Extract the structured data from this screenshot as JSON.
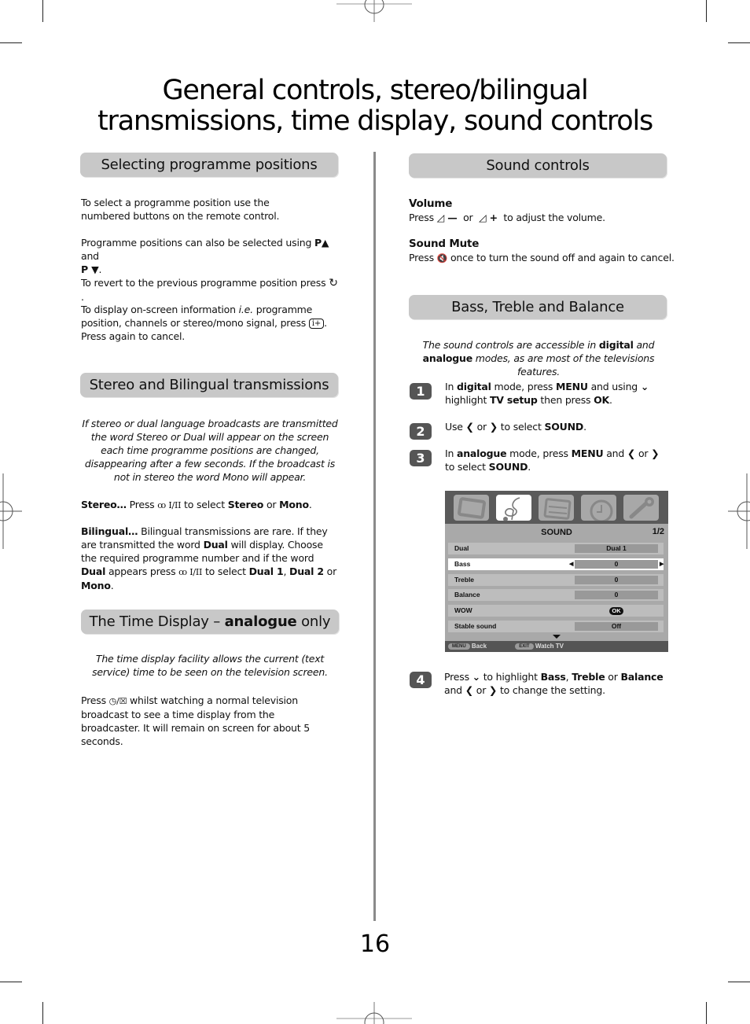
{
  "page": {
    "title_line1": "General controls, stereo/bilingual",
    "title_line2": "transmissions, time display, sound controls",
    "page_number": "16"
  },
  "left": {
    "selecting": {
      "heading": "Selecting programme positions",
      "p1": "To select a programme position use the numbered buttons on the remote control.",
      "p2_a": "Programme positions can also be selected using ",
      "p2_b": "P▲",
      "p2_c": " and ",
      "p2_d": "P ▼",
      "p2_e": ".",
      "p3_a": "To revert to the previous programme position press ",
      "p3_icon": "↻",
      "p3_b": ".",
      "p4_a": "To display on-screen information ",
      "p4_ie": "i.e.",
      "p4_b": " programme position, channels or stereo/mono signal, press ",
      "p4_icon": "i+",
      "p4_c": ". Press again to cancel."
    },
    "stereo": {
      "heading": "Stereo and Bilingual transmissions",
      "intro": "If stereo or dual language broadcasts are transmitted the word Stereo or Dual will appear on the screen each time programme positions are changed, disappearing after a few seconds. If the broadcast is not in stereo the word Mono will appear.",
      "stereo_lead": "Stereo…",
      "stereo_a": " Press ",
      "stereo_icon": "ꝏ I/II",
      "stereo_b": " to select ",
      "stereo_c": "Stereo",
      "stereo_d": " or ",
      "stereo_e": "Mono",
      "stereo_f": ".",
      "bi_lead": "Bilingual…",
      "bi_a": " Bilingual transmissions are rare. If they are transmitted the word ",
      "bi_b": "Dual",
      "bi_c": " will display. Choose the required programme number and if the word ",
      "bi_d": "Dual",
      "bi_e": " appears press ",
      "bi_icon": "ꝏ I/II",
      "bi_f": " to select ",
      "bi_g": "Dual 1",
      "bi_h": ", ",
      "bi_i": "Dual 2",
      "bi_j": " or ",
      "bi_k": "Mono",
      "bi_l": "."
    },
    "time": {
      "heading_a": "The Time Display – ",
      "heading_b": "analogue",
      "heading_c": " only",
      "intro": "The time display facility allows the current (text service) time to be seen on the television screen.",
      "p_a": "Press ",
      "p_icon": "◷/☒",
      "p_b": " whilst watching a normal television broadcast to see a time display from the broadcaster. It will remain on screen for about 5 seconds."
    }
  },
  "right": {
    "sound": {
      "heading": "Sound controls",
      "volume_title": "Volume",
      "volume_a": "Press ",
      "volume_minus": "◿ —",
      "volume_b": "  or  ",
      "volume_plus": "◿ +",
      "volume_c": "  to adjust the volume.",
      "mute_title": "Sound Mute",
      "mute_a": "Press ",
      "mute_icon": "🔇",
      "mute_b": " once to turn the sound off and again to cancel."
    },
    "btb": {
      "heading": "Bass, Treble and Balance",
      "intro_a": "The sound controls are accessible in ",
      "intro_b": "digital",
      "intro_c": " and ",
      "intro_d": "analogue",
      "intro_e": " modes, as are most of the televisions features.",
      "steps": [
        {
          "num": "1",
          "a": "In ",
          "b": "digital",
          "c": " mode, press ",
          "d": "MENU",
          "e": " and using ",
          "f": "⌄",
          "g": " highlight ",
          "h": "TV setup",
          "i": " then press ",
          "j": "OK",
          "k": "."
        },
        {
          "num": "2",
          "a": "Use ",
          "b": "❮",
          "c": " or ",
          "d": "❯",
          "e": " to select ",
          "f": "SOUND",
          "g": "."
        },
        {
          "num": "3",
          "a": "In ",
          "b": "analogue",
          "c": " mode, press ",
          "d": "MENU",
          "e": " and ",
          "f": "❮",
          "g": " or ",
          "h": "❯",
          "i": " to select ",
          "j": "SOUND",
          "k": "."
        },
        {
          "num": "4",
          "a": "Press ",
          "b": "⌄",
          "c": " to highlight ",
          "d": "Bass",
          "e": ", ",
          "f": "Treble",
          "g": " or ",
          "h": "Balance",
          "i": " and ",
          "j": "❮",
          "k": " or ",
          "l": "❯",
          "m": " to change the setting."
        }
      ]
    },
    "osd": {
      "icons": [
        "tv-icon",
        "music-note-icon",
        "sliders-icon",
        "clock-icon",
        "wrench-icon"
      ],
      "selected_icon": 1,
      "title": "SOUND",
      "page": "1/2",
      "rows": [
        {
          "label": "Dual",
          "value": "Dual 1"
        },
        {
          "label": "Bass",
          "value": "0"
        },
        {
          "label": "Treble",
          "value": "0"
        },
        {
          "label": "Balance",
          "value": "0"
        },
        {
          "label": "WOW",
          "value": "OK"
        },
        {
          "label": "Stable sound",
          "value": "Off"
        }
      ],
      "highlighted_row": 1,
      "footer": {
        "menu_key": "MENU",
        "menu_label": "Back",
        "exit_key": "EXIT",
        "exit_label": "Watch TV"
      }
    }
  }
}
